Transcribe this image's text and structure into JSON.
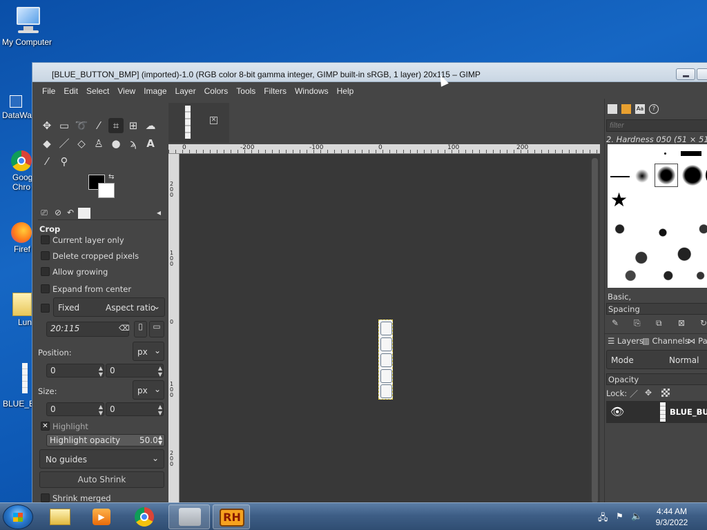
{
  "desktop": {
    "icons": [
      {
        "label": "My Computer"
      },
      {
        "label": "DataWa"
      },
      {
        "label": "Goog Chro"
      },
      {
        "label": "Firef"
      },
      {
        "label": "Lun"
      },
      {
        "label": "BLUE_B"
      }
    ]
  },
  "window": {
    "title": "[BLUE_BUTTON_BMP] (imported)-1.0 (RGB color 8-bit gamma integer, GIMP built-in sRGB, 1 layer) 20x115 – GIMP"
  },
  "menu": [
    "File",
    "Edit",
    "Select",
    "View",
    "Image",
    "Layer",
    "Colors",
    "Tools",
    "Filters",
    "Windows",
    "Help"
  ],
  "toolbox": {
    "tools_row1": [
      "move-icon",
      "rect-select-icon",
      "lasso-icon",
      "fuzzy-select-icon",
      "crop-icon",
      "unified-transform-icon",
      "warp-icon"
    ],
    "tools_row2": [
      "bucket-fill-icon",
      "paintbrush-icon",
      "eraser-icon",
      "clone-icon",
      "smudge-icon",
      "path-icon",
      "text-icon"
    ],
    "tools_row3": [
      "color-picker-icon",
      "zoom-icon"
    ],
    "fg_color": "#000000",
    "bg_color": "#ffffff"
  },
  "tool_options": {
    "title": "Crop",
    "current_layer_only": "Current layer only",
    "delete_cropped": "Delete cropped pixels",
    "allow_growing": "Allow growing",
    "expand_center": "Expand from center",
    "fixed": "Fixed",
    "aspect_ratio": "Aspect ratio",
    "ratio_value": "20:115",
    "position_label": "Position:",
    "position_unit": "px",
    "position_x": "0",
    "position_y": "0",
    "size_label": "Size:",
    "size_unit": "px",
    "size_w": "0",
    "size_h": "0",
    "highlight": "Highlight",
    "highlight_opacity_label": "Highlight opacity",
    "highlight_opacity_value": "50.0",
    "guides": "No guides",
    "auto_shrink": "Auto Shrink",
    "shrink_merged": "Shrink merged"
  },
  "ruler": {
    "h_ticks": [
      "0",
      "-200",
      "-100",
      "0",
      "100",
      "200"
    ],
    "v_ticks": [
      "2\n0\n0",
      "1\n0\n0",
      "0",
      "1\n0\n0",
      "2\n0\n0"
    ]
  },
  "image_swatches": [
    "#f2f6fa",
    "#f7edb8",
    "#dfe4e8",
    "#f2f2e6",
    "#cfe2f5"
  ],
  "brushes": {
    "filter_placeholder": "filter",
    "selected": "2. Hardness 050 (51 × 51)",
    "preset": "Basic,",
    "spacing": "Spacing"
  },
  "layers": {
    "tabs": [
      "Layers",
      "Channels",
      "Pat"
    ],
    "mode_label": "Mode",
    "mode_value": "Normal",
    "opacity_label": "Opacity",
    "lock_label": "Lock:",
    "layer_name": "BLUE_BUT"
  },
  "taskbar": {
    "time": "4:44 AM",
    "date": "9/3/2022",
    "rh_label": "RH"
  }
}
